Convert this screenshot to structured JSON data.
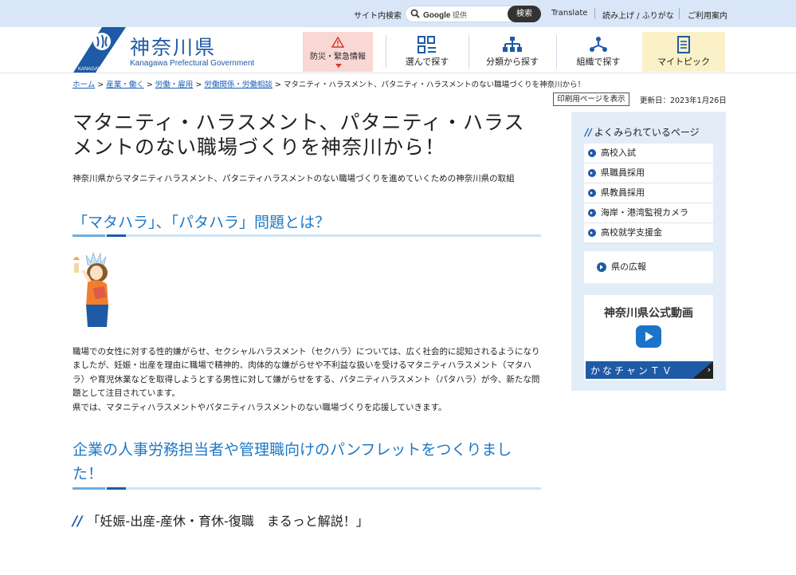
{
  "topbar": {
    "search_label": "サイト内検索",
    "search_provider": "Google",
    "search_provider_suffix": "提供",
    "search_button": "検索",
    "links": [
      "Translate",
      "読み上げ / ふりがな",
      "ご利用案内"
    ]
  },
  "header": {
    "logo_title": "神奈川県",
    "logo_subtitle": "Kanagawa Prefectural Government",
    "logo_band_text": "KANAGAWA",
    "nav": {
      "emergency": "防災・緊急情報",
      "choose": "選んで探す",
      "category": "分類から探す",
      "organization": "組織で探す",
      "mytopic": "マイトピック"
    }
  },
  "breadcrumb": {
    "items": [
      "ホーム",
      "産業・働く",
      "労働・雇用",
      "労働関係・労働相談"
    ],
    "separator": ">",
    "current": "マタニティ・ハラスメント、パタニティ・ハラスメントのない職場づくりを神奈川から！"
  },
  "print_button": "印刷用ページを表示",
  "updated": "更新日：2023年1月26日",
  "main": {
    "title": "マタニティ・ハラスメント、パタニティ・ハラスメントのない職場づくりを神奈川から！",
    "lead": "神奈川県からマタニティハラスメント、パタニティハラスメントのない職場づくりを進めていくための神奈川県の取組",
    "section1_heading": "「マタハラ」、「パタハラ」問題とは？",
    "section1_body": "職場での女性に対する性的嫌がらせ、セクシャルハラスメント（セクハラ）については、広く社会的に認知されるようになりましたが、妊娠・出産を理由に職場で精神的、肉体的な嫌がらせや不利益な扱いを受けるマタニティハラスメント（マタハラ）や育児休業などを取得しようとする男性に対して嫌がらせをする、パタニティハラスメント（パタハラ）が今、新たな問題として注目されています。",
    "section1_body2": "県では、マタニティハラスメントやパタニティハラスメントのない職場づくりを応援していきます。",
    "section2_heading": "企業の人事労務担当者や管理職向けのパンフレットをつくりました！",
    "section3_heading": "「妊娠-出産-産休・育休-復職　まるっと解説！」"
  },
  "sidebar": {
    "heading": "よくみられているページ",
    "items": [
      "高校入試",
      "県職員採用",
      "県教員採用",
      "海岸・港湾監視カメラ",
      "高校就学支援金"
    ],
    "koho": "県の広報",
    "video_title": "神奈川県公式動画",
    "video_band": "かなチャンＴＶ"
  },
  "colors": {
    "brand_blue": "#1f5aa6",
    "heading_blue": "#1f78c4",
    "topbar_bg": "#d9e6f7",
    "emergency_bg": "#f8d7d4",
    "mytopic_bg": "#fbf1c8",
    "sidebar_bg": "#e3edf8"
  },
  "icons": {
    "search": "search-icon",
    "emergency": "warning-icon",
    "choose": "grid-icon",
    "category": "hierarchy-icon",
    "organization": "org-icon",
    "mytopic": "notebook-icon",
    "play": "play-icon"
  }
}
